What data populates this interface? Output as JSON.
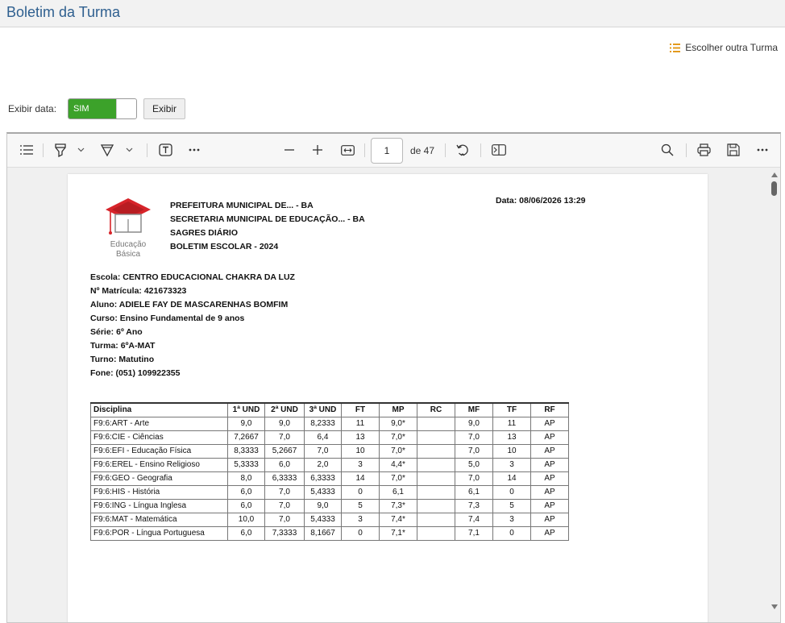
{
  "app": {
    "title": "Boletim da Turma",
    "choose_class_label": "Escolher outra Turma"
  },
  "controls": {
    "date_label": "Exibir data:",
    "toggle_value": "SIM",
    "show_button": "Exibir"
  },
  "pdf_toolbar": {
    "page_current": "1",
    "page_total_label": "de 47",
    "icons": [
      "contents-icon",
      "highlight-icon",
      "chevron-down-icon",
      "draw-icon",
      "chevron-down-icon",
      "text-icon",
      "more-icon",
      "zoom-out-icon",
      "zoom-in-icon",
      "fit-width-icon",
      "rotate-icon",
      "page-view-icon",
      "search-icon",
      "print-icon",
      "save-icon",
      "more-icon"
    ]
  },
  "document": {
    "header_lines": [
      "PREFEITURA MUNICIPAL DE... - BA",
      "SECRETARIA MUNICIPAL DE EDUCAÇÃO... - BA",
      "SAGRES DIÁRIO",
      "BOLETIM ESCOLAR - 2024"
    ],
    "date_line": "Data:  08/06/2026 13:29",
    "logo_text": [
      "Educação",
      "Básica"
    ],
    "info": {
      "escola": "Escola:  CENTRO EDUCACIONAL CHAKRA DA LUZ",
      "matricula": "Nº Matrícula: 421673323",
      "aluno": "Aluno: ADIELE FAY DE MASCARENHAS BOMFIM",
      "curso": "Curso: Ensino Fundamental de 9 anos",
      "serie": "Série:   6º Ano",
      "turma": "Turma:  6ºA-MAT",
      "turno": "Turno:   Matutino",
      "fone": "Fone: (051) 109922355"
    },
    "table": {
      "headers": [
        "Disciplina",
        "1ª UND",
        "2ª UND",
        "3ª UND",
        "FT",
        "MP",
        "RC",
        "MF",
        "TF",
        "RF"
      ],
      "rows": [
        [
          "F9:6:ART - Arte",
          "9,0",
          "9,0",
          "8,2333",
          "11",
          "9,0*",
          "",
          "9,0",
          "11",
          "AP"
        ],
        [
          "F9:6:CIE - Ciências",
          "7,2667",
          "7,0",
          "6,4",
          "13",
          "7,0*",
          "",
          "7,0",
          "13",
          "AP"
        ],
        [
          "F9:6:EFI - Educação Física",
          "8,3333",
          "5,2667",
          "7,0",
          "10",
          "7,0*",
          "",
          "7,0",
          "10",
          "AP"
        ],
        [
          "F9:6:EREL - Ensino Religioso",
          "5,3333",
          "6,0",
          "2,0",
          "3",
          "4,4*",
          "",
          "5,0",
          "3",
          "AP"
        ],
        [
          "F9:6:GEO - Geografia",
          "8,0",
          "6,3333",
          "6,3333",
          "14",
          "7,0*",
          "",
          "7,0",
          "14",
          "AP"
        ],
        [
          "F9:6:HIS - História",
          "6,0",
          "7,0",
          "5,4333",
          "0",
          "6,1",
          "",
          "6,1",
          "0",
          "AP"
        ],
        [
          "F9:6:ING - Língua Inglesa",
          "6,0",
          "7,0",
          "9,0",
          "5",
          "7,3*",
          "",
          "7,3",
          "5",
          "AP"
        ],
        [
          "F9:6:MAT - Matemática",
          "10,0",
          "7,0",
          "5,4333",
          "3",
          "7,4*",
          "",
          "7,4",
          "3",
          "AP"
        ],
        [
          "F9:6:POR - Língua Portuguesa",
          "6,0",
          "7,3333",
          "8,1667",
          "0",
          "7,1*",
          "",
          "7,1",
          "0",
          "AP"
        ]
      ]
    }
  },
  "colors": {
    "title": "#2e5f8f",
    "toggle_on": "#3ca22a",
    "list_icon": "#e39a1c"
  }
}
